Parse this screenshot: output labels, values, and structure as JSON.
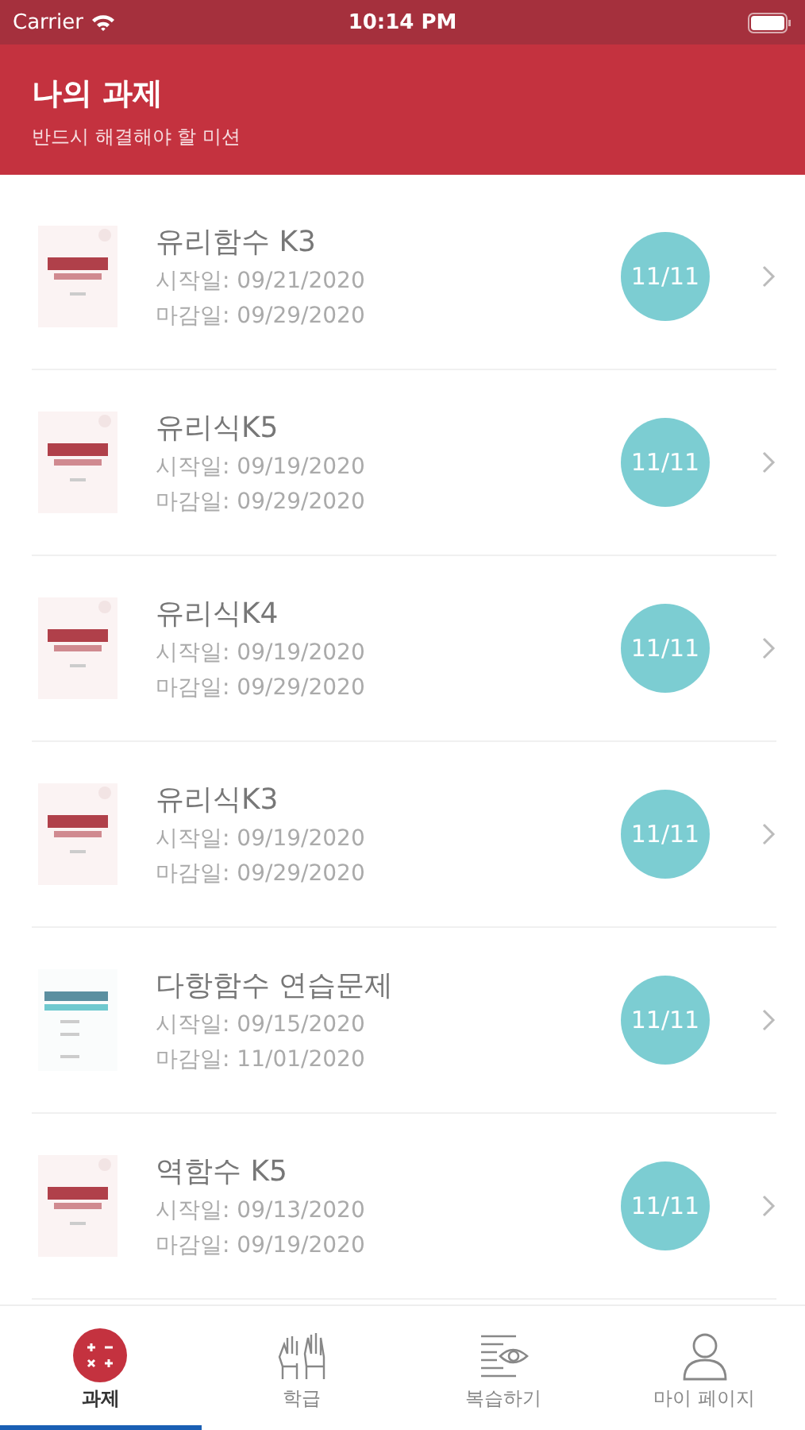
{
  "status_bar": {
    "carrier": "Carrier",
    "time": "10:14 PM"
  },
  "header": {
    "title": "나의 과제",
    "subtitle": "반드시 해결해야 할 미션"
  },
  "assignments": [
    {
      "kind": "red",
      "title": "유리함수 K3",
      "start": "시작일: 09/21/2020",
      "due": "마감일: 09/29/2020",
      "progress": "11/11"
    },
    {
      "kind": "red",
      "title": "유리식K5",
      "start": "시작일: 09/19/2020",
      "due": "마감일: 09/29/2020",
      "progress": "11/11"
    },
    {
      "kind": "red",
      "title": "유리식K4",
      "start": "시작일: 09/19/2020",
      "due": "마감일: 09/29/2020",
      "progress": "11/11"
    },
    {
      "kind": "red",
      "title": "유리식K3",
      "start": "시작일: 09/19/2020",
      "due": "마감일: 09/29/2020",
      "progress": "11/11"
    },
    {
      "kind": "teal",
      "title": "다항함수 연습문제",
      "start": "시작일: 09/15/2020",
      "due": "마감일: 11/01/2020",
      "progress": "11/11"
    },
    {
      "kind": "red",
      "title": "역함수 K5",
      "start": "시작일: 09/13/2020",
      "due": "마감일: 09/19/2020",
      "progress": "11/11"
    }
  ],
  "tabs": [
    {
      "kind": "calculator",
      "label": "과제",
      "selected": true
    },
    {
      "kind": "hands",
      "label": "학급",
      "selected": false
    },
    {
      "kind": "review",
      "label": "복습하기",
      "selected": false
    },
    {
      "kind": "person",
      "label": "마이 페이지",
      "selected": false
    }
  ]
}
